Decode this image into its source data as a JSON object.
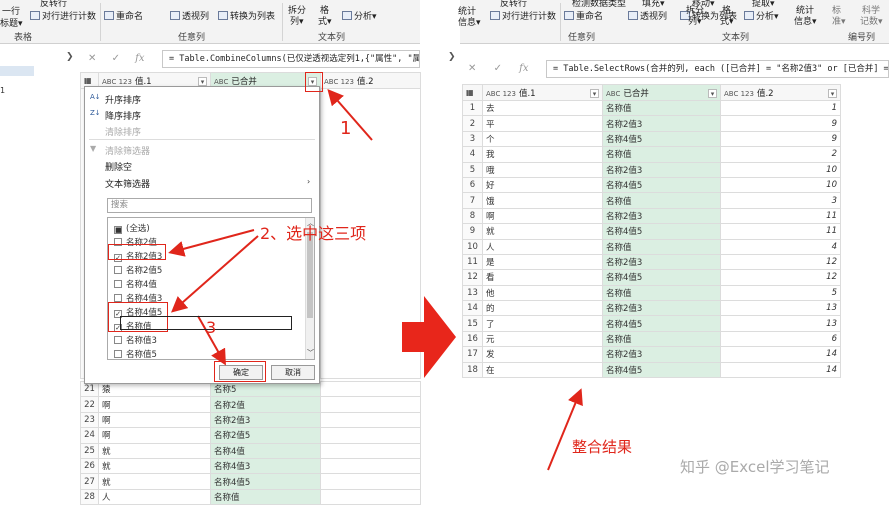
{
  "left_ribbon": {
    "items": [
      {
        "id": "a",
        "label": "一行"
      },
      {
        "id": "b",
        "label": "标题▾"
      },
      {
        "id": "c",
        "label": "反转行"
      },
      {
        "id": "d",
        "label": "对行进行计数"
      },
      {
        "id": "e",
        "label": "重命名"
      },
      {
        "id": "f",
        "label": "透视列"
      },
      {
        "id": "g",
        "label": "转换为列表"
      },
      {
        "id": "h",
        "label": "拆分"
      },
      {
        "id": "i",
        "label": "列▾"
      },
      {
        "id": "j",
        "label": "格"
      },
      {
        "id": "k",
        "label": "式▾"
      },
      {
        "id": "l",
        "label": "分析▾"
      }
    ],
    "groups": {
      "table": "表格",
      "any_column": "任意列",
      "text_column": "文本列"
    }
  },
  "right_ribbon": {
    "items": [
      {
        "id": "a",
        "label": "统计"
      },
      {
        "id": "b",
        "label": "信息▾"
      },
      {
        "id": "c",
        "label": "反转行"
      },
      {
        "id": "d",
        "label": "对行进行计数"
      },
      {
        "id": "e",
        "label": "检测数据类型"
      },
      {
        "id": "f",
        "label": "填充▾"
      },
      {
        "id": "g",
        "label": "重命名"
      },
      {
        "id": "h",
        "label": "透视列"
      },
      {
        "id": "i",
        "label": "移动▾"
      },
      {
        "id": "j",
        "label": "转换为列表"
      },
      {
        "id": "k",
        "label": "拆分"
      },
      {
        "id": "l",
        "label": "列▾"
      },
      {
        "id": "m",
        "label": "格"
      },
      {
        "id": "n",
        "label": "式▾"
      },
      {
        "id": "o",
        "label": "提取▾"
      },
      {
        "id": "p",
        "label": "分析▾"
      },
      {
        "id": "q",
        "label": "统计"
      },
      {
        "id": "r",
        "label": "信息▾"
      },
      {
        "id": "s",
        "label": "标"
      },
      {
        "id": "t",
        "label": "准▾"
      },
      {
        "id": "u",
        "label": "科学"
      },
      {
        "id": "v",
        "label": "记数▾"
      }
    ],
    "groups": {
      "any_column": "任意列",
      "text_column": "文本列",
      "number_column": "编号列"
    }
  },
  "left_formula": "= Table.CombineColumns(已仅逆透视选定列1,{\"属性\", \"属性.1\"",
  "right_formula": "= Table.SelectRows(合并的列, each ([已合并] = \"名称2值3\" or [已合并] =",
  "fx": "fx",
  "left_table": {
    "headers": {
      "col1": "值.1",
      "col2": "已合并",
      "col3": "值.2"
    },
    "header_type_icons": {
      "col1": "ABC 123",
      "col2": "ABC",
      "col3": "ABC 123"
    },
    "visible_rows": [
      {
        "n": "21",
        "v1": "猿",
        "v2": "名称5"
      },
      {
        "n": "22",
        "v1": "啊",
        "v2": "名称2值"
      },
      {
        "n": "23",
        "v1": "啊",
        "v2": "名称2值3"
      },
      {
        "n": "24",
        "v1": "啊",
        "v2": "名称2值5"
      },
      {
        "n": "25",
        "v1": "就",
        "v2": "名称4值"
      },
      {
        "n": "26",
        "v1": "就",
        "v2": "名称4值3"
      },
      {
        "n": "27",
        "v1": "就",
        "v2": "名称4值5"
      },
      {
        "n": "28",
        "v1": "人",
        "v2": "名称值"
      }
    ],
    "side_fragment": "1"
  },
  "filter_menu": {
    "sort_asc": "升序排序",
    "sort_desc": "降序排序",
    "clear_sort": "清除排序",
    "clear_filter": "清除筛选器",
    "remove_empty": "删除空",
    "text_filters": "文本筛选器",
    "search_placeholder": "搜索",
    "options": [
      {
        "label": "(全选)",
        "state": "partial"
      },
      {
        "label": "名称2值",
        "state": "unchecked"
      },
      {
        "label": "名称2值3",
        "state": "checked"
      },
      {
        "label": "名称2值5",
        "state": "unchecked"
      },
      {
        "label": "名称4值",
        "state": "unchecked"
      },
      {
        "label": "名称4值3",
        "state": "unchecked"
      },
      {
        "label": "名称4值5",
        "state": "checked"
      },
      {
        "label": "名称值",
        "state": "checked"
      },
      {
        "label": "名称值3",
        "state": "unchecked"
      },
      {
        "label": "名称值5",
        "state": "unchecked"
      }
    ],
    "ok": "确定",
    "cancel": "取消"
  },
  "right_table": {
    "headers": {
      "col1": "值.1",
      "col2": "已合并",
      "col3": "值.2"
    },
    "header_type_icons": {
      "col1": "ABC 123",
      "col2": "ABC",
      "col3": "ABC 123"
    },
    "rows": [
      {
        "n": "1",
        "v1": "去",
        "v2": "名称值",
        "v3": "1"
      },
      {
        "n": "2",
        "v1": "平",
        "v2": "名称2值3",
        "v3": "9"
      },
      {
        "n": "3",
        "v1": "个",
        "v2": "名称4值5",
        "v3": "9"
      },
      {
        "n": "4",
        "v1": "我",
        "v2": "名称值",
        "v3": "2"
      },
      {
        "n": "5",
        "v1": "哦",
        "v2": "名称2值3",
        "v3": "10"
      },
      {
        "n": "6",
        "v1": "好",
        "v2": "名称4值5",
        "v3": "10"
      },
      {
        "n": "7",
        "v1": "饿",
        "v2": "名称值",
        "v3": "3"
      },
      {
        "n": "8",
        "v1": "啊",
        "v2": "名称2值3",
        "v3": "11"
      },
      {
        "n": "9",
        "v1": "就",
        "v2": "名称4值5",
        "v3": "11"
      },
      {
        "n": "10",
        "v1": "人",
        "v2": "名称值",
        "v3": "4"
      },
      {
        "n": "11",
        "v1": "是",
        "v2": "名称2值3",
        "v3": "12"
      },
      {
        "n": "12",
        "v1": "看",
        "v2": "名称4值5",
        "v3": "12"
      },
      {
        "n": "13",
        "v1": "他",
        "v2": "名称值",
        "v3": "5"
      },
      {
        "n": "14",
        "v1": "的",
        "v2": "名称2值3",
        "v3": "13"
      },
      {
        "n": "15",
        "v1": "了",
        "v2": "名称4值5",
        "v3": "13"
      },
      {
        "n": "16",
        "v1": "元",
        "v2": "名称值",
        "v3": "6"
      },
      {
        "n": "17",
        "v1": "发",
        "v2": "名称2值3",
        "v3": "14"
      },
      {
        "n": "18",
        "v1": "在",
        "v2": "名称4值5",
        "v3": "14"
      }
    ]
  },
  "annotations": {
    "step1": "1",
    "step2": "2、选中这三项",
    "step3": "3",
    "result": "整合结果",
    "watermark": "知乎 @Excel学习笔记"
  },
  "colors": {
    "annotation_red": "#e0261b",
    "merged_column_green": "#dbefe2"
  }
}
